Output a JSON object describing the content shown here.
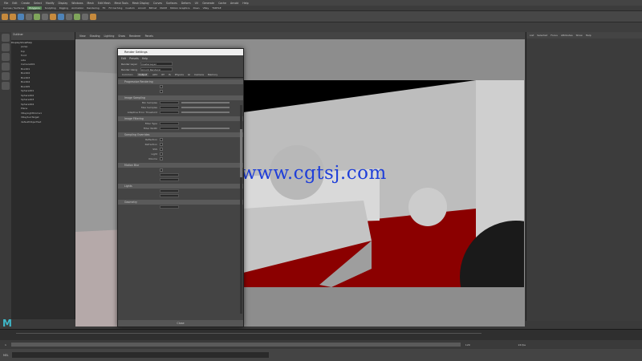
{
  "menubar": {
    "items": [
      "File",
      "Edit",
      "Create",
      "Select",
      "Modify",
      "Display",
      "Windows",
      "Mesh",
      "Edit Mesh",
      "Mesh Tools",
      "Mesh Display",
      "Curves",
      "Surfaces",
      "Deform",
      "UV",
      "Generate",
      "Cache",
      "Arnold",
      "Help"
    ],
    "workspace": "Maya Classic"
  },
  "shelf_tabs": [
    "Curves / Surfaces",
    "Polygons",
    "Sculpting",
    "Rigging",
    "Animation",
    "Rendering",
    "FX",
    "FX Caching",
    "Custom",
    "Arnold",
    "Bifrost",
    "MASH",
    "Motion Graphics",
    "XGen",
    "VRay",
    "TURTLE"
  ],
  "outliner": {
    "title": "Outliner",
    "menu": [
      "Display",
      "Show",
      "Help"
    ],
    "items": [
      "persp",
      "top",
      "front",
      "side",
      "Camera001",
      "Box001",
      "Box002",
      "Box003",
      "Box004",
      "Box005",
      "Sphere001",
      "Sphere002",
      "Sphere003",
      "Sphere004",
      "Plane",
      "VRayLightDome1",
      "VRaySunTarget",
      "defaultObjectSet"
    ]
  },
  "panel_menu": [
    "View",
    "Shading",
    "Lighting",
    "Show",
    "Renderer",
    "Panels"
  ],
  "render_settings": {
    "title": "Render Settings",
    "menu": [
      "Edit",
      "Presets",
      "Help"
    ],
    "render_layer_label": "Render Layer",
    "render_layer_value": "masterLayer",
    "render_using_label": "Render Using",
    "render_using_value": "Arnold Renderer",
    "tabs": [
      "Common",
      "Output",
      "AOV",
      "RT",
      "IS",
      "Physics",
      "GI",
      "Camera",
      "Memory"
    ],
    "active_tab": "Output",
    "sections": {
      "progressive": "Progressive Rendering",
      "image_sampler": "Image Sampling",
      "image_filter": "Image Filtering",
      "sampling_overrides": "Sampling Overrides",
      "motion_blur": "Motion Blur",
      "lights": "Lights",
      "mesh": "Geometry"
    },
    "fields": {
      "min_samples": "Min Samples",
      "max_samples": "Max Samples",
      "adaptive_threshold": "Adaptive Error Threshold",
      "filter_type": "Filter Type",
      "filter_width": "Filter Width",
      "reflection": "Reflection",
      "refraction": "Refraction",
      "sss": "SSS",
      "light": "Light",
      "volume": "Volume"
    },
    "close_label": "Close"
  },
  "timeline": {
    "start": "1",
    "end": "120",
    "fps": "24 fps"
  },
  "watermark": "www.cgtsj.com",
  "logo": "M",
  "command_label": "MEL",
  "colors": {
    "floor": "#8b0000",
    "maya_logo": "#3fb8c9",
    "watermark": "#1f3fd9"
  }
}
